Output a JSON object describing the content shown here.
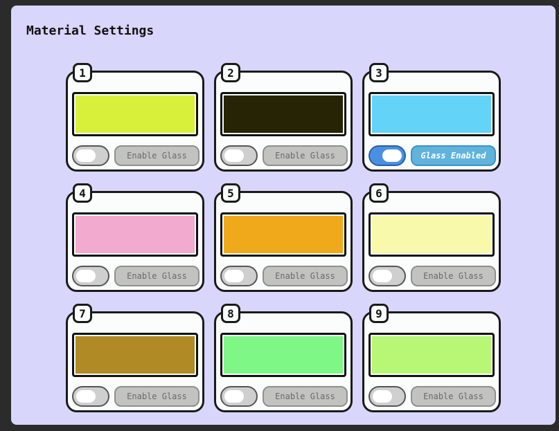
{
  "header": {
    "title": "Material Settings"
  },
  "materials": [
    {
      "number": "1",
      "color": "#d8f03a",
      "glass_enabled": false,
      "button_label": "Enable Glass"
    },
    {
      "number": "2",
      "color": "#262405",
      "glass_enabled": false,
      "button_label": "Enable Glass"
    },
    {
      "number": "3",
      "color": "#64d3f8",
      "glass_enabled": true,
      "button_label": "Glass Enabled"
    },
    {
      "number": "4",
      "color": "#f2aacf",
      "glass_enabled": false,
      "button_label": "Enable Glass"
    },
    {
      "number": "5",
      "color": "#f0a91a",
      "glass_enabled": false,
      "button_label": "Enable Glass"
    },
    {
      "number": "6",
      "color": "#f8f9aa",
      "glass_enabled": false,
      "button_label": "Enable Glass"
    },
    {
      "number": "7",
      "color": "#b08a25",
      "glass_enabled": false,
      "button_label": "Enable Glass"
    },
    {
      "number": "8",
      "color": "#7ef787",
      "glass_enabled": false,
      "button_label": "Enable Glass"
    },
    {
      "number": "9",
      "color": "#b8f775",
      "glass_enabled": false,
      "button_label": "Enable Glass"
    }
  ]
}
